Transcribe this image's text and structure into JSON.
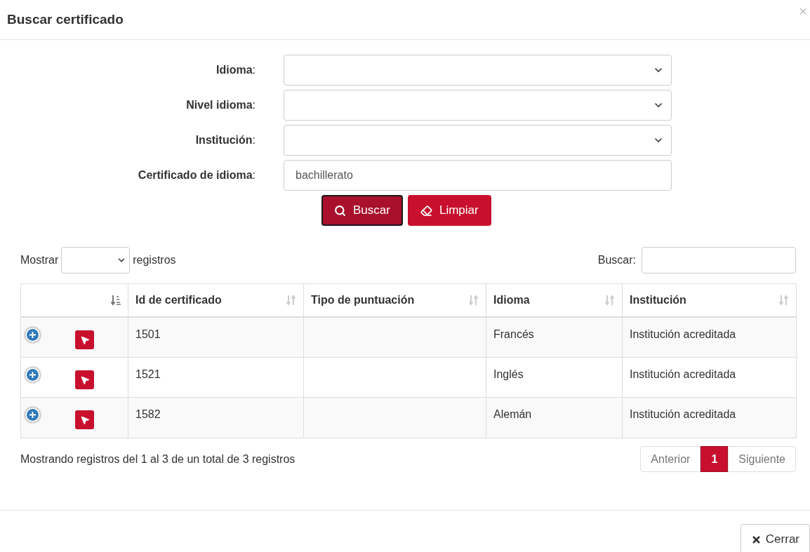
{
  "modal": {
    "title": "Buscar certificado",
    "close": "×"
  },
  "form": {
    "fields": [
      {
        "kind": "select",
        "label": "**Idioma**:"
      },
      {
        "kind": "select",
        "label": "**Nivel idioma**:"
      },
      {
        "kind": "select",
        "label": "**Institución**:"
      },
      {
        "kind": "text",
        "label": "**Certificado de idioma**:",
        "value": "bachillerato"
      }
    ],
    "buttons": [
      {
        "kind": "search",
        "label": "Buscar",
        "selected": true
      },
      {
        "kind": "clear",
        "label": "Limpiar",
        "selected": false
      }
    ]
  },
  "table_controls": {
    "show_label": "Mostrar",
    "show_suffix": "registros",
    "search_label": "Buscar:"
  },
  "table": {
    "columns": [
      "Id de certificado",
      "Tipo de puntuación",
      "Idioma",
      "Institución"
    ],
    "rows": [
      {
        "cells": [
          "1501",
          "",
          "Francés",
          "Institución acreditada"
        ]
      },
      {
        "cells": [
          "1521",
          "",
          "Inglés",
          "Institución acreditada"
        ]
      },
      {
        "cells": [
          "1582",
          "",
          "Alemán",
          "Institución acreditada"
        ]
      }
    ]
  },
  "info": "Mostrando registros del 1 al 3 de un total de 3 registros",
  "pagination": [
    {
      "label": "Anterior",
      "selected": false
    },
    {
      "label": "1",
      "selected": true
    },
    {
      "label": "Siguiente",
      "selected": false
    }
  ],
  "footer": {
    "close_button": "Cerrar"
  }
}
